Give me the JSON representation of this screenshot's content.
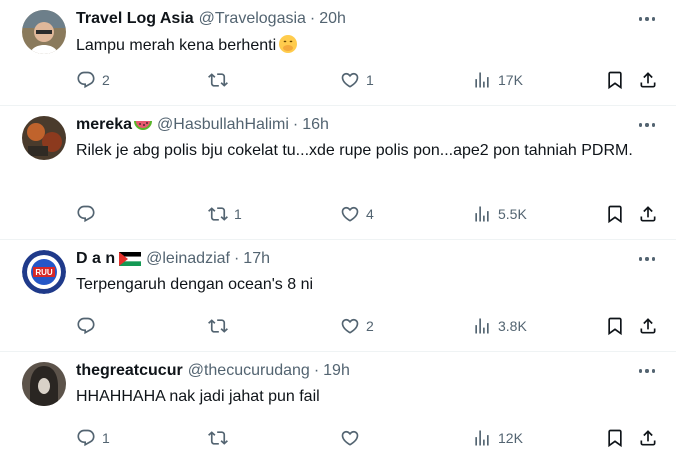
{
  "tweets": [
    {
      "name": "Travel Log Asia",
      "handle": "@Travelogasia",
      "dot": "·",
      "time": "20h",
      "text": "Lampu merah kena berhenti",
      "text_emoji": "hand-over-mouth-emoji",
      "replies": "2",
      "retweets": "",
      "likes": "1",
      "views": "17K"
    },
    {
      "name": "mereka",
      "name_emoji": "watermelon-emoji",
      "handle": "@HasbullahHalimi",
      "dot": "·",
      "time": "16h",
      "text": "Rilek je abg polis bju cokelat tu...xde rupe polis pon...ape2 pon tahniah PDRM.",
      "replies": "",
      "retweets": "1",
      "likes": "4",
      "views": "5.5K"
    },
    {
      "name": "D a n",
      "name_emoji": "palestine-flag-emoji",
      "handle": "@leinadziaf",
      "dot": "·",
      "time": "17h",
      "text": "Terpengaruh dengan ocean's 8 ni",
      "avatar_text": "RUU",
      "replies": "",
      "retweets": "",
      "likes": "2",
      "views": "3.8K"
    },
    {
      "name": "thegreatcucur",
      "handle": "@thecucurudang",
      "dot": "·",
      "time": "19h",
      "text": "HHAHHAHA nak jadi jahat pun fail",
      "replies": "1",
      "retweets": "",
      "likes": "",
      "views": "12K"
    }
  ],
  "icons": {
    "reply": "reply-icon",
    "retweet": "retweet-icon",
    "like": "heart-icon",
    "views": "views-icon",
    "bookmark": "bookmark-icon",
    "share": "share-icon",
    "more": "more-icon"
  },
  "colors": {
    "text": "#0f1419",
    "secondary": "#536471",
    "divider": "#eff3f4"
  }
}
